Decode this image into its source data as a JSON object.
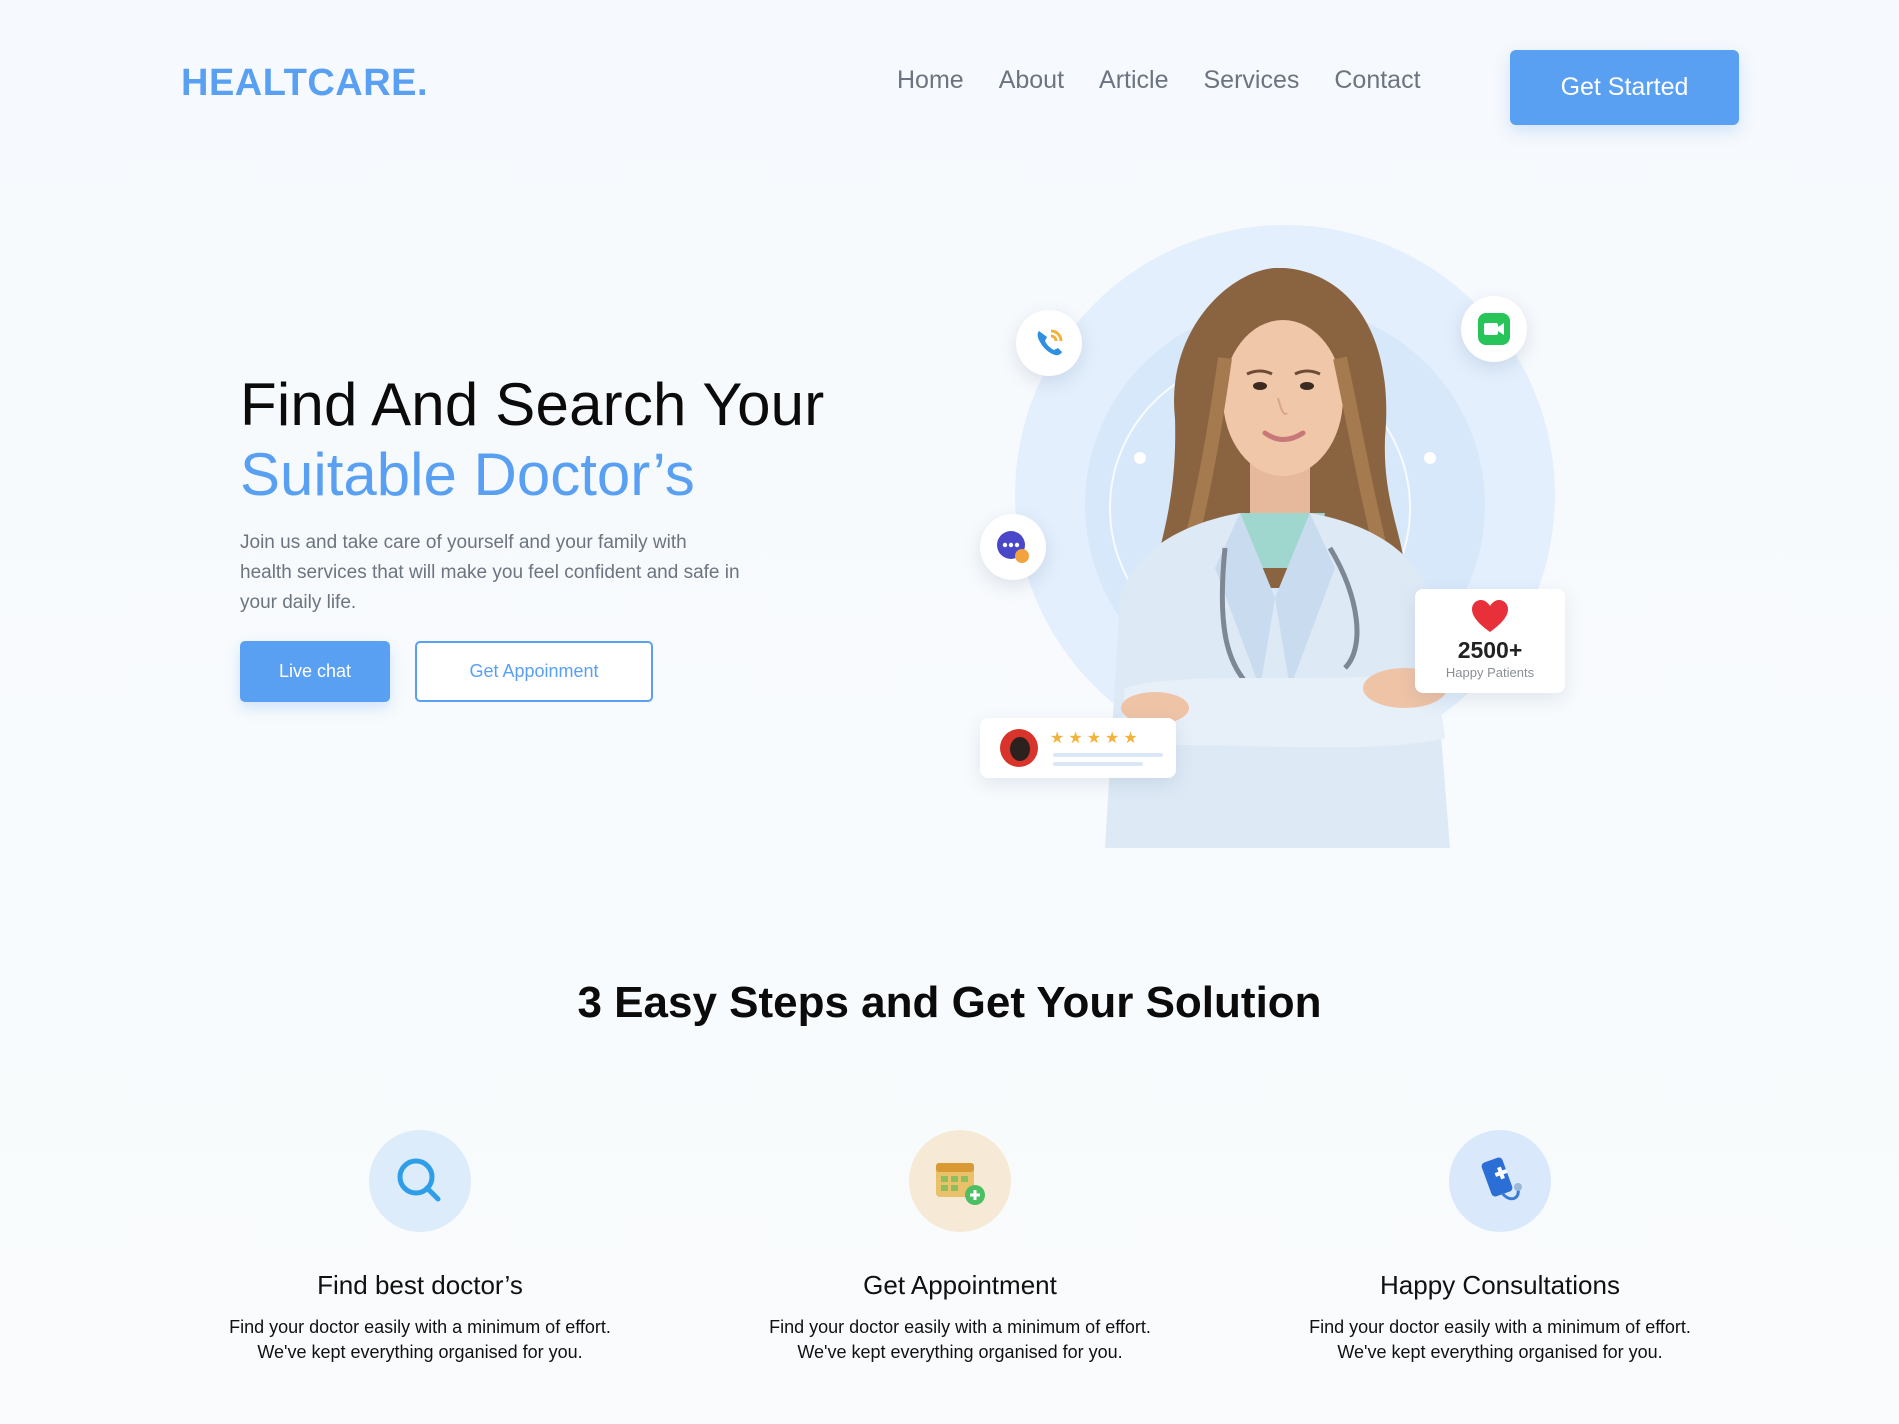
{
  "header": {
    "logo": "HEALTCARE.",
    "nav": [
      "Home",
      "About",
      "Article",
      "Services",
      "Contact"
    ],
    "cta_label": "Get Started"
  },
  "hero": {
    "title_line1": "Find And Search Your",
    "title_line2": "Suitable Doctor’s",
    "description": "Join us and take care of yourself and your family with health services that will make you feel confident and safe in your daily life.",
    "live_chat_label": "Live chat",
    "appointment_label": "Get Appoinment",
    "patients_count": "2500+",
    "patients_label": "Happy Patients",
    "rating_stars": 5
  },
  "steps": {
    "title": "3 Easy Steps and Get Your Solution",
    "items": [
      {
        "title": "Find best doctor’s",
        "desc_line1": "Find your doctor easily with a minimum of effort.",
        "desc_line2": "We've kept everything organised for you.",
        "icon": "search-icon"
      },
      {
        "title": "Get Appointment",
        "desc_line1": "Find your doctor easily with a minimum of effort.",
        "desc_line2": "We've kept everything organised for you.",
        "icon": "calendar-icon"
      },
      {
        "title": "Happy Consultations",
        "desc_line1": "Find your doctor easily with a minimum of effort.",
        "desc_line2": "We've kept everything organised for you.",
        "icon": "medical-phone-icon"
      }
    ]
  },
  "colors": {
    "accent": "#5aa0f2",
    "text_muted": "#6b7480",
    "background": "#f7fafd"
  }
}
